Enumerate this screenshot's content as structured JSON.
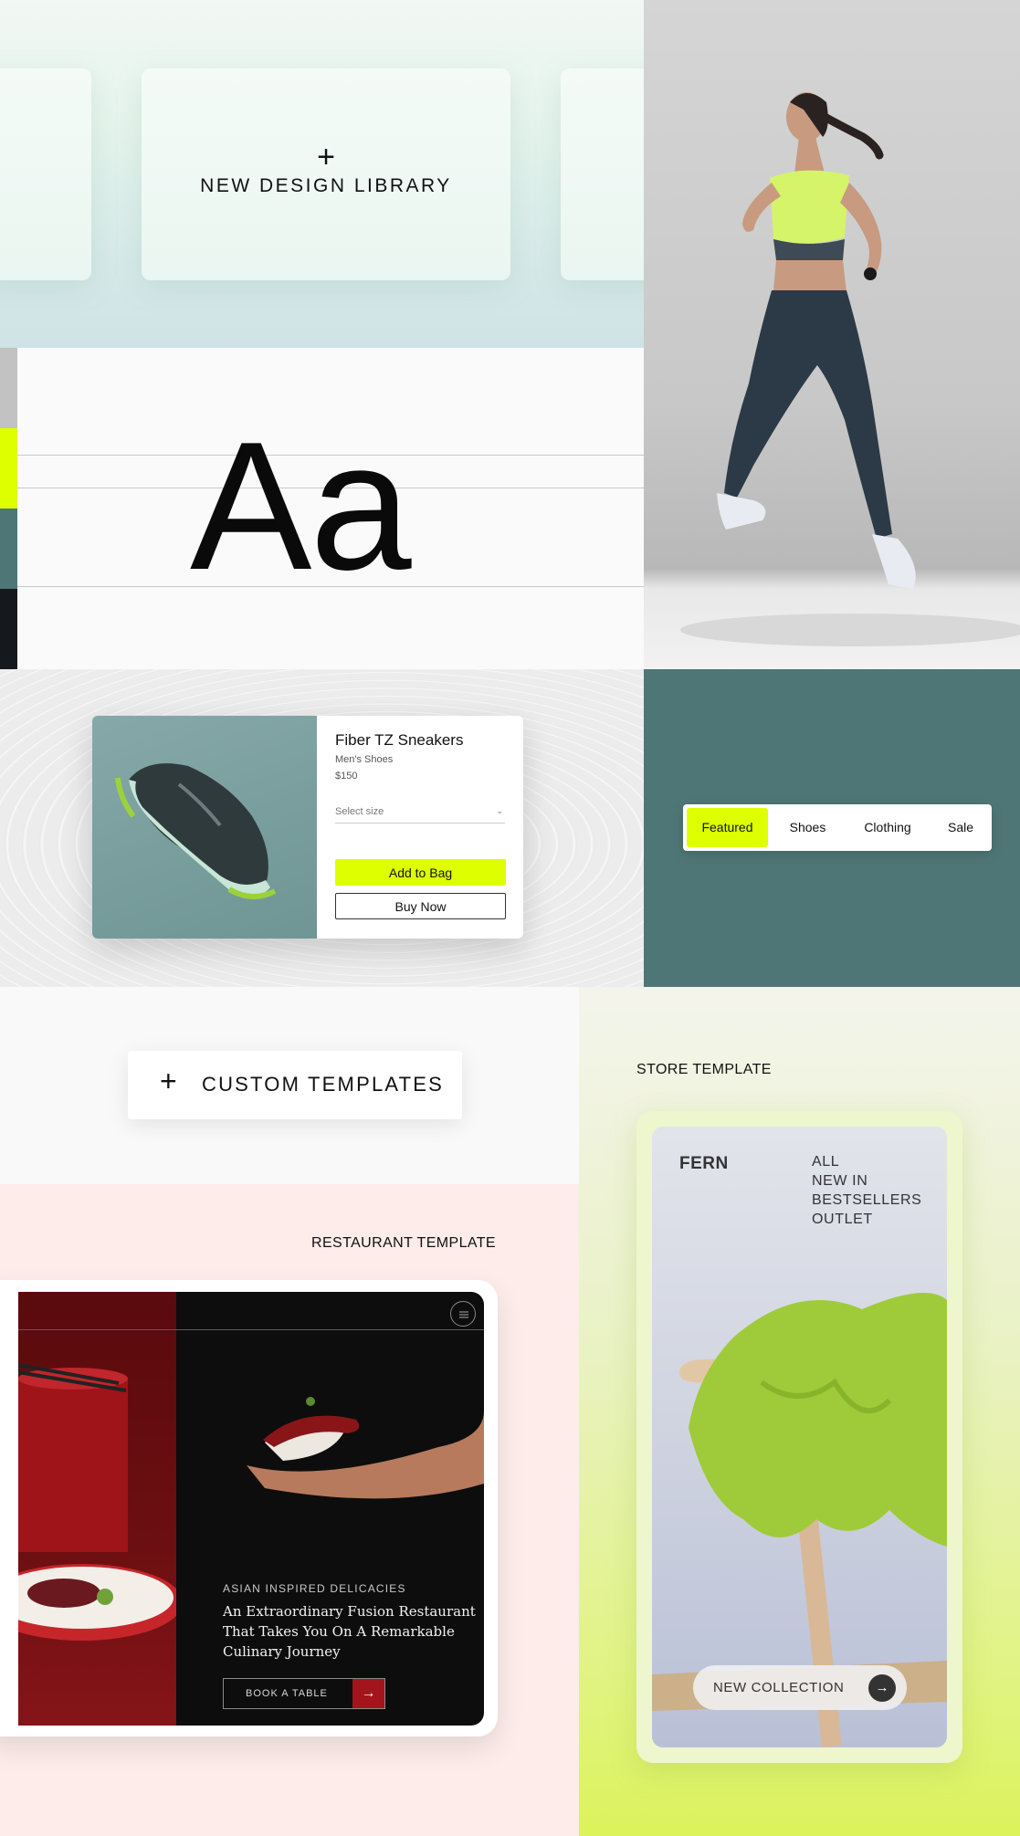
{
  "library": {
    "plus_icon": "+",
    "label": "NEW DESIGN LIBRARY"
  },
  "typography": {
    "sample": "Aa",
    "swatches": [
      "#c2c2c2",
      "#ddff00",
      "#4f7676",
      "#15191d"
    ]
  },
  "product": {
    "title": "Fiber TZ Sneakers",
    "subtitle": "Men's Shoes",
    "price": "$150",
    "size_placeholder": "Select size",
    "size_chevron": "⌄",
    "add_to_bag": "Add to Bag",
    "buy_now": "Buy Now"
  },
  "nav": {
    "tabs": [
      {
        "label": "Featured",
        "active": true
      },
      {
        "label": "Shoes",
        "active": false
      },
      {
        "label": "Clothing",
        "active": false
      },
      {
        "label": "Sale",
        "active": false
      }
    ]
  },
  "custom": {
    "plus_icon": "+",
    "label": "CUSTOM TEMPLATES"
  },
  "restaurant": {
    "section_label": "RESTAURANT TEMPLATE",
    "kicker": "ASIAN INSPIRED DELICACIES",
    "headline": "An Extraordinary Fusion Restaurant That Takes You On A Remarkable Culinary Journey",
    "book_button": "BOOK A TABLE",
    "book_arrow": "→"
  },
  "store": {
    "section_label": "STORE TEMPLATE",
    "brand": "FERN",
    "menu": [
      "ALL",
      "NEW IN",
      "BESTSELLERS",
      "OUTLET"
    ],
    "cta": "NEW COLLECTION",
    "cta_arrow": "→"
  },
  "colors": {
    "accent_lime": "#ddff00",
    "teal": "#4f7676",
    "restaurant_red": "#a3151c"
  }
}
